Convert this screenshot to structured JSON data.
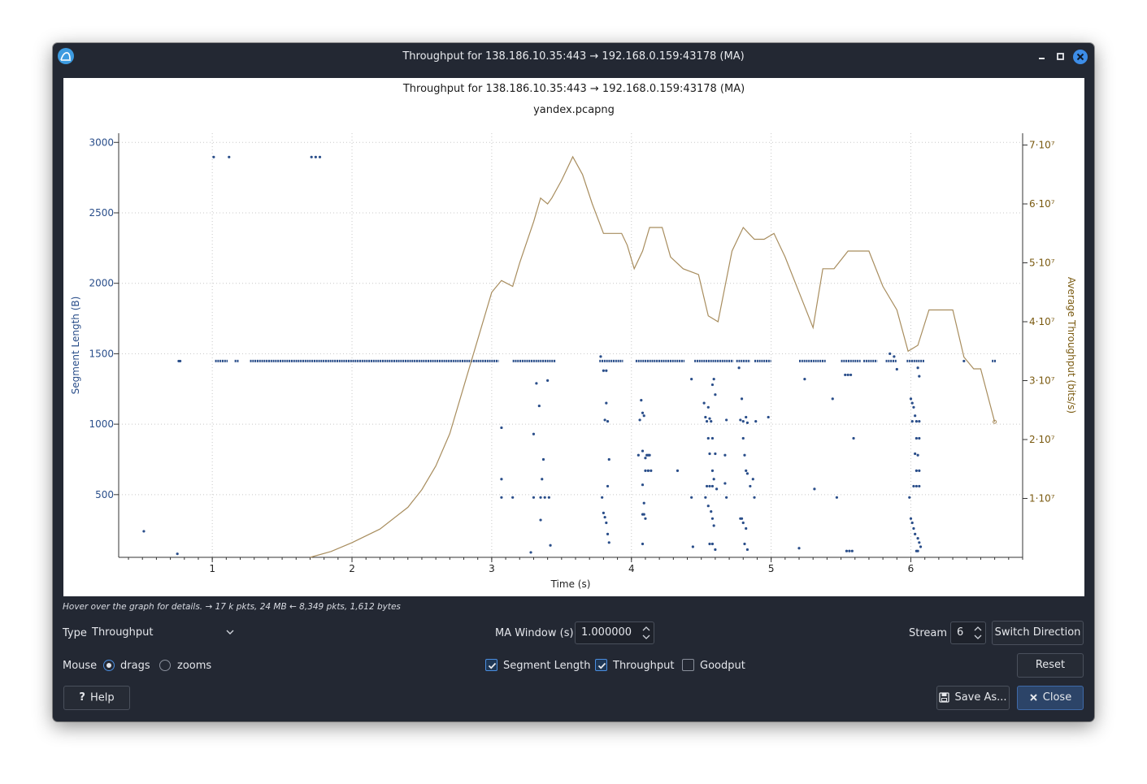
{
  "window": {
    "title": "Throughput for 138.186.10.35:443 → 192.168.0.159:43178 (MA)"
  },
  "chart_data": {
    "type": "scatter+line",
    "title": "Throughput for 138.186.10.35:443 → 192.168.0.159:43178 (MA)",
    "subtitle": "yandex.pcapng",
    "xlabel": "Time (s)",
    "ylabel_left": "Segment Length (B)",
    "ylabel_right": "Average Throughput (bits/s)",
    "xlim": [
      0.33,
      6.8
    ],
    "ylim_left": [
      55,
      3065
    ],
    "ylim_right": [
      0,
      72000000
    ],
    "x_ticks": [
      "1",
      "2",
      "3",
      "4",
      "5",
      "6"
    ],
    "y_left_ticks": [
      "500",
      "1000",
      "1500",
      "2000",
      "2500",
      "3000"
    ],
    "y_right_ticks": [
      "1·10⁷",
      "2·10⁷",
      "3·10⁷",
      "4·10⁷",
      "5·10⁷",
      "6·10⁷",
      "7·10⁷"
    ],
    "grid": true,
    "colors": {
      "segment": "#2a4e8a",
      "throughput": "#a88d5e",
      "right_axis": "#7a5a10",
      "left_axis": "#2a4e8a"
    },
    "series": [
      {
        "name": "Segment Length",
        "kind": "scatter",
        "points": [
          [
            0.51,
            240
          ],
          [
            0.75,
            80
          ],
          [
            0.76,
            1448
          ],
          [
            0.77,
            1448
          ],
          [
            1.01,
            2896
          ],
          [
            1.12,
            2896
          ],
          [
            1.71,
            2896
          ],
          [
            1.74,
            2896
          ],
          [
            1.77,
            2896
          ],
          [
            3.07,
            975
          ],
          [
            3.07,
            610
          ],
          [
            3.07,
            480
          ],
          [
            3.15,
            480
          ],
          [
            3.3,
            930
          ],
          [
            3.3,
            480
          ],
          [
            3.32,
            1290
          ],
          [
            3.34,
            1130
          ],
          [
            3.36,
            610
          ],
          [
            3.35,
            320
          ],
          [
            3.37,
            750
          ],
          [
            3.4,
            1310
          ],
          [
            3.41,
            480
          ],
          [
            3.42,
            140
          ],
          [
            3.28,
            90
          ],
          [
            3.35,
            480
          ],
          [
            3.38,
            480
          ],
          [
            3.78,
            1480
          ],
          [
            3.8,
            1380
          ],
          [
            3.82,
            1380
          ],
          [
            3.82,
            1150
          ],
          [
            3.81,
            1030
          ],
          [
            3.83,
            1020
          ],
          [
            3.84,
            750
          ],
          [
            3.83,
            560
          ],
          [
            3.79,
            480
          ],
          [
            3.8,
            370
          ],
          [
            3.81,
            340
          ],
          [
            3.82,
            300
          ],
          [
            3.83,
            220
          ],
          [
            3.84,
            160
          ],
          [
            4.07,
            1170
          ],
          [
            4.08,
            1080
          ],
          [
            4.09,
            1060
          ],
          [
            4.06,
            1030
          ],
          [
            4.05,
            780
          ],
          [
            4.08,
            810
          ],
          [
            4.1,
            760
          ],
          [
            4.11,
            780
          ],
          [
            4.12,
            780
          ],
          [
            4.13,
            780
          ],
          [
            4.1,
            670
          ],
          [
            4.12,
            670
          ],
          [
            4.14,
            670
          ],
          [
            4.08,
            570
          ],
          [
            4.09,
            440
          ],
          [
            4.08,
            360
          ],
          [
            4.09,
            360
          ],
          [
            4.1,
            330
          ],
          [
            4.08,
            150
          ],
          [
            4.33,
            670
          ],
          [
            4.43,
            480
          ],
          [
            4.43,
            1320
          ],
          [
            4.44,
            130
          ],
          [
            4.52,
            1150
          ],
          [
            4.53,
            1050
          ],
          [
            4.54,
            1020
          ],
          [
            4.55,
            1120
          ],
          [
            4.56,
            1040
          ],
          [
            4.57,
            1020
          ],
          [
            4.58,
            1280
          ],
          [
            4.59,
            1320
          ],
          [
            4.6,
            1210
          ],
          [
            4.55,
            900
          ],
          [
            4.56,
            790
          ],
          [
            4.58,
            900
          ],
          [
            4.6,
            790
          ],
          [
            4.58,
            670
          ],
          [
            4.54,
            560
          ],
          [
            4.56,
            560
          ],
          [
            4.58,
            560
          ],
          [
            4.59,
            610
          ],
          [
            4.61,
            540
          ],
          [
            4.53,
            480
          ],
          [
            4.55,
            420
          ],
          [
            4.57,
            380
          ],
          [
            4.58,
            330
          ],
          [
            4.59,
            280
          ],
          [
            4.56,
            150
          ],
          [
            4.58,
            150
          ],
          [
            4.6,
            110
          ],
          [
            4.68,
            1030
          ],
          [
            4.68,
            480
          ],
          [
            4.67,
            780
          ],
          [
            4.67,
            580
          ],
          [
            4.77,
            1400
          ],
          [
            4.79,
            1180
          ],
          [
            4.78,
            1030
          ],
          [
            4.8,
            1020
          ],
          [
            4.82,
            1050
          ],
          [
            4.83,
            1010
          ],
          [
            4.8,
            900
          ],
          [
            4.81,
            780
          ],
          [
            4.82,
            670
          ],
          [
            4.83,
            650
          ],
          [
            4.85,
            560
          ],
          [
            4.78,
            330
          ],
          [
            4.79,
            330
          ],
          [
            4.8,
            300
          ],
          [
            4.82,
            260
          ],
          [
            4.81,
            150
          ],
          [
            4.83,
            110
          ],
          [
            4.87,
            610
          ],
          [
            4.88,
            480
          ],
          [
            4.89,
            1020
          ],
          [
            4.98,
            1050
          ],
          [
            5.2,
            120
          ],
          [
            5.24,
            1320
          ],
          [
            5.31,
            540
          ],
          [
            5.44,
            1180
          ],
          [
            5.47,
            480
          ],
          [
            5.53,
            1350
          ],
          [
            5.55,
            1350
          ],
          [
            5.57,
            1350
          ],
          [
            5.59,
            900
          ],
          [
            5.54,
            100
          ],
          [
            5.56,
            100
          ],
          [
            5.58,
            100
          ],
          [
            5.85,
            1500
          ],
          [
            5.88,
            1480
          ],
          [
            5.9,
            1390
          ],
          [
            6.0,
            1180
          ],
          [
            6.01,
            1150
          ],
          [
            6.02,
            1120
          ],
          [
            6.03,
            1060
          ],
          [
            6.01,
            1020
          ],
          [
            6.04,
            1020
          ],
          [
            6.06,
            1020
          ],
          [
            6.04,
            900
          ],
          [
            6.06,
            900
          ],
          [
            6.03,
            790
          ],
          [
            6.05,
            780
          ],
          [
            6.04,
            670
          ],
          [
            6.06,
            670
          ],
          [
            6.02,
            560
          ],
          [
            6.04,
            560
          ],
          [
            6.06,
            560
          ],
          [
            5.99,
            480
          ],
          [
            6.0,
            330
          ],
          [
            6.01,
            300
          ],
          [
            6.02,
            260
          ],
          [
            6.03,
            220
          ],
          [
            6.05,
            190
          ],
          [
            6.06,
            160
          ],
          [
            6.07,
            130
          ],
          [
            6.04,
            100
          ],
          [
            6.05,
            100
          ],
          [
            6.06,
            1340
          ],
          [
            6.05,
            1400
          ],
          [
            6.38,
            1448
          ]
        ],
        "bands": [
          [
            1.02,
            1.11,
            1448
          ],
          [
            1.16,
            1.19,
            1448
          ],
          [
            1.27,
            3.05,
            1448
          ],
          [
            3.15,
            3.46,
            1448
          ],
          [
            3.77,
            3.94,
            1448
          ],
          [
            4.03,
            4.38,
            1448
          ],
          [
            4.45,
            4.73,
            1448
          ],
          [
            4.75,
            4.85,
            1448
          ],
          [
            4.88,
            5.0,
            1448
          ],
          [
            5.2,
            5.39,
            1448
          ],
          [
            5.5,
            5.64,
            1448
          ],
          [
            5.66,
            5.76,
            1448
          ],
          [
            5.82,
            5.9,
            1448
          ],
          [
            5.97,
            6.1,
            1448
          ],
          [
            6.58,
            6.61,
            1448
          ]
        ]
      },
      {
        "name": "Throughput",
        "kind": "line",
        "points": [
          [
            1.7,
            0
          ],
          [
            1.85,
            1000000
          ],
          [
            2.0,
            2500000
          ],
          [
            2.2,
            4800000
          ],
          [
            2.4,
            8500000
          ],
          [
            2.5,
            11500000
          ],
          [
            2.6,
            15500000
          ],
          [
            2.7,
            21000000
          ],
          [
            2.8,
            29000000
          ],
          [
            2.9,
            37000000
          ],
          [
            3.0,
            45000000
          ],
          [
            3.07,
            47000000
          ],
          [
            3.15,
            46000000
          ],
          [
            3.2,
            50000000
          ],
          [
            3.3,
            57000000
          ],
          [
            3.35,
            61000000
          ],
          [
            3.4,
            60000000
          ],
          [
            3.43,
            61000000
          ],
          [
            3.5,
            64000000
          ],
          [
            3.58,
            68000000
          ],
          [
            3.65,
            65000000
          ],
          [
            3.72,
            60000000
          ],
          [
            3.8,
            55000000
          ],
          [
            3.93,
            55000000
          ],
          [
            3.97,
            53000000
          ],
          [
            4.02,
            49000000
          ],
          [
            4.08,
            52000000
          ],
          [
            4.13,
            56000000
          ],
          [
            4.22,
            56000000
          ],
          [
            4.28,
            51000000
          ],
          [
            4.37,
            49000000
          ],
          [
            4.48,
            48000000
          ],
          [
            4.55,
            41000000
          ],
          [
            4.62,
            40000000
          ],
          [
            4.72,
            52000000
          ],
          [
            4.8,
            56000000
          ],
          [
            4.84,
            55000000
          ],
          [
            4.88,
            54000000
          ],
          [
            4.95,
            54000000
          ],
          [
            5.02,
            55000000
          ],
          [
            5.1,
            51000000
          ],
          [
            5.2,
            45000000
          ],
          [
            5.3,
            39000000
          ],
          [
            5.37,
            49000000
          ],
          [
            5.45,
            49000000
          ],
          [
            5.55,
            52000000
          ],
          [
            5.7,
            52000000
          ],
          [
            5.8,
            46000000
          ],
          [
            5.9,
            42000000
          ],
          [
            5.98,
            35000000
          ],
          [
            6.05,
            36000000
          ],
          [
            6.13,
            42000000
          ],
          [
            6.3,
            42000000
          ],
          [
            6.38,
            34000000
          ],
          [
            6.45,
            32000000
          ],
          [
            6.5,
            32000000
          ],
          [
            6.6,
            23000000
          ]
        ]
      }
    ]
  },
  "status": "Hover over the graph for details. → 17 k pkts, 24 MB ← 8,349 pkts, 1,612 bytes",
  "controls": {
    "type_label": "Type",
    "type_value": "Throughput",
    "ma_label": "MA Window (s)",
    "ma_value": "1.000000",
    "stream_label": "Stream",
    "stream_value": "6",
    "switch_direction": "Switch Direction",
    "mouse_label": "Mouse",
    "drags": "drags",
    "zooms": "zooms",
    "segment_length": "Segment Length",
    "throughput": "Throughput",
    "goodput": "Goodput",
    "reset": "Reset",
    "help": "Help",
    "save_as": "Save As...",
    "close": "Close"
  }
}
